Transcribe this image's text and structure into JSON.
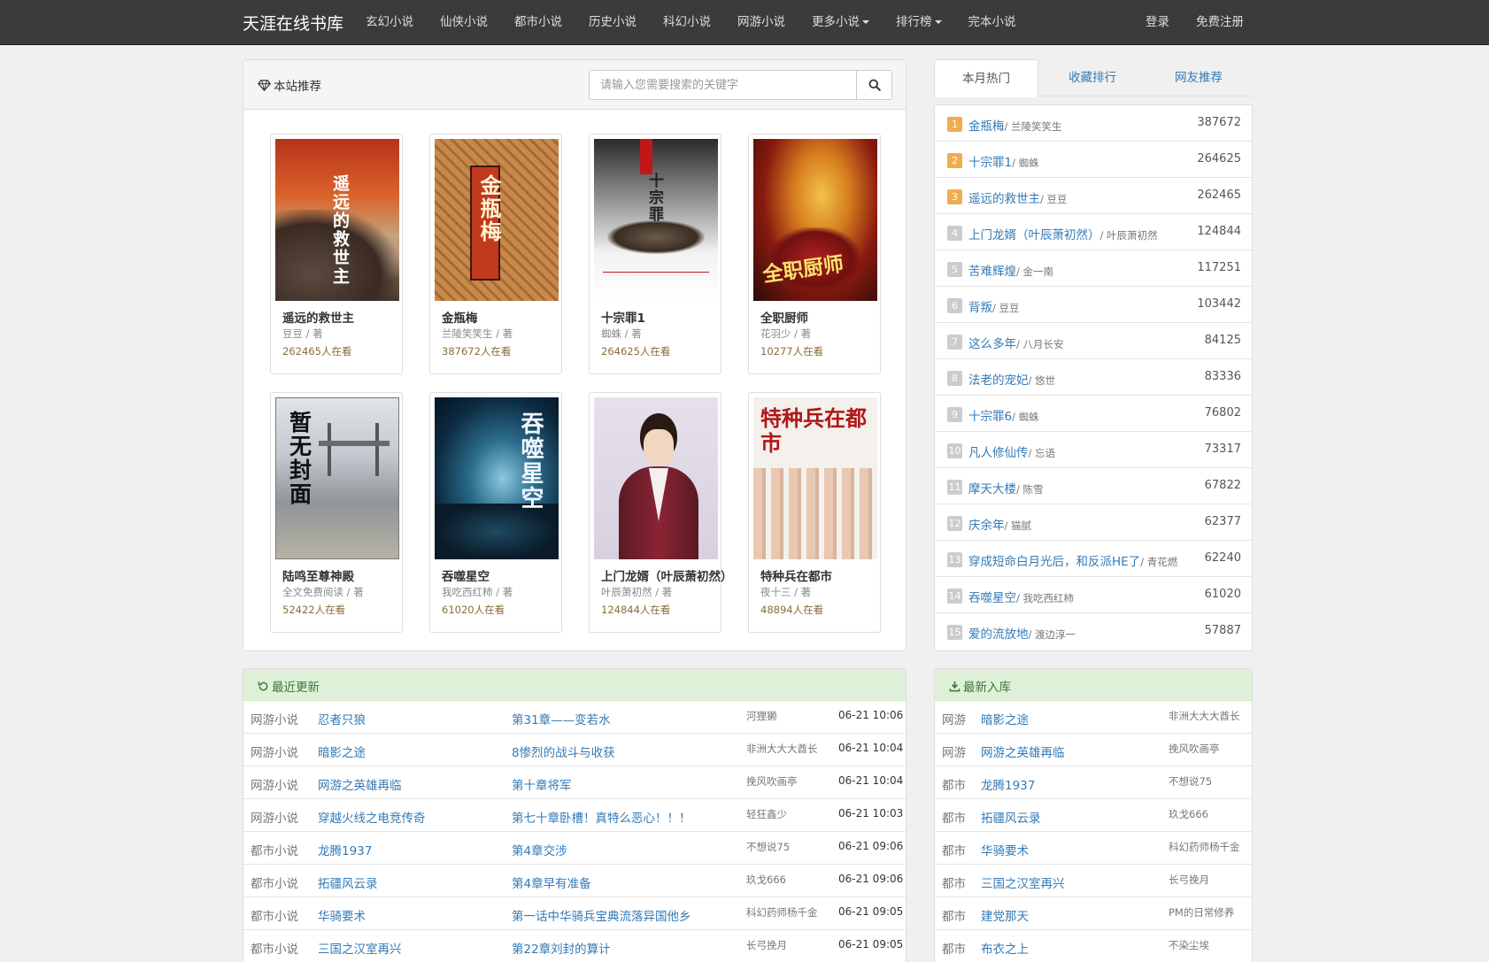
{
  "nav": {
    "brand": "天涯在线书库",
    "links": [
      "玄幻小说",
      "仙侠小说",
      "都市小说",
      "历史小说",
      "科幻小说",
      "网游小说",
      "更多小说",
      "排行榜",
      "完本小说"
    ],
    "login": "登录",
    "register": "免费注册"
  },
  "recommend": {
    "title": "本站推荐",
    "search_placeholder": "请输入您需要搜索的关键字",
    "books": [
      {
        "title": "遥远的救世主",
        "author": "豆豆 / 著",
        "readers": "262465人在看",
        "cover_text": "遥远的救世主"
      },
      {
        "title": "金瓶梅",
        "author": "兰陵笑笑生 / 著",
        "readers": "387672人在看",
        "cover_text": "金瓶梅"
      },
      {
        "title": "十宗罪1",
        "author": "蜘蛛 / 著",
        "readers": "264625人在看",
        "cover_text": "十宗罪"
      },
      {
        "title": "全职厨师",
        "author": "花羽少 / 著",
        "readers": "10277人在看",
        "cover_text": "全职厨师"
      },
      {
        "title": "陆鸣至尊神殿",
        "author": "全文免费阅读 / 著",
        "readers": "52422人在看",
        "cover_text": "暂无封面"
      },
      {
        "title": "吞噬星空",
        "author": "我吃西红柿 / 著",
        "readers": "61020人在看",
        "cover_text": "吞噬星空"
      },
      {
        "title": "上门龙婿（叶辰萧初然）",
        "author": "叶辰萧初然 / 著",
        "readers": "124844人在看",
        "cover_text": ""
      },
      {
        "title": "特种兵在都市",
        "author": "夜十三 / 著",
        "readers": "48894人在看",
        "cover_text": "特种兵在都市"
      }
    ]
  },
  "hot": {
    "tabs": [
      "本月热门",
      "收藏排行",
      "网友推荐"
    ],
    "items": [
      {
        "num": "1",
        "title": "金瓶梅",
        "author": "/ 兰陵笑笑生",
        "count": "387672"
      },
      {
        "num": "2",
        "title": "十宗罪1",
        "author": "/ 蜘蛛",
        "count": "264625"
      },
      {
        "num": "3",
        "title": "遥远的救世主",
        "author": "/ 豆豆",
        "count": "262465"
      },
      {
        "num": "4",
        "title": "上门龙婿（叶辰萧初然）",
        "author": "/ 叶辰萧初然",
        "count": "124844"
      },
      {
        "num": "5",
        "title": "苦难辉煌",
        "author": "/ 金一南",
        "count": "117251"
      },
      {
        "num": "6",
        "title": "背叛",
        "author": "/ 豆豆",
        "count": "103442"
      },
      {
        "num": "7",
        "title": "这么多年",
        "author": "/ 八月长安",
        "count": "84125"
      },
      {
        "num": "8",
        "title": "法老的宠妃",
        "author": "/ 悠世",
        "count": "83336"
      },
      {
        "num": "9",
        "title": "十宗罪6",
        "author": "/ 蜘蛛",
        "count": "76802"
      },
      {
        "num": "10",
        "title": "凡人修仙传",
        "author": "/ 忘语",
        "count": "73317"
      },
      {
        "num": "11",
        "title": "摩天大楼",
        "author": "/ 陈雪",
        "count": "67822"
      },
      {
        "num": "12",
        "title": "庆余年",
        "author": "/ 猫腻",
        "count": "62377"
      },
      {
        "num": "13",
        "title": "穿成短命白月光后，和反派HE了",
        "author": "/ 青花燃",
        "count": "62240"
      },
      {
        "num": "14",
        "title": "吞噬星空",
        "author": "/ 我吃西红柿",
        "count": "61020"
      },
      {
        "num": "15",
        "title": "爱的流放地",
        "author": "/ 渡边淳一",
        "count": "57887"
      }
    ]
  },
  "updates": {
    "title": "最近更新",
    "rows": [
      {
        "cat": "网游小说",
        "book": "忍者只狼",
        "chapter": "第31章——变若水",
        "author": "河狸獭",
        "time": "06-21 10:06"
      },
      {
        "cat": "网游小说",
        "book": "暗影之途",
        "chapter": "8惨烈的战斗与收获",
        "author": "非洲大大大酋长",
        "time": "06-21 10:04"
      },
      {
        "cat": "网游小说",
        "book": "网游之英雄再临",
        "chapter": "第十章将军",
        "author": "挽风吹画亭",
        "time": "06-21 10:04"
      },
      {
        "cat": "网游小说",
        "book": "穿越火线之电竞传奇",
        "chapter": "第七十章卧槽！真特么恶心！！！",
        "author": "轻狂鑫少",
        "time": "06-21 10:03"
      },
      {
        "cat": "都市小说",
        "book": "龙腾1937",
        "chapter": "第4章交涉",
        "author": "不想说75",
        "time": "06-21 09:06"
      },
      {
        "cat": "都市小说",
        "book": "拓疆风云录",
        "chapter": "第4章早有准备",
        "author": "玖戈666",
        "time": "06-21 09:06"
      },
      {
        "cat": "都市小说",
        "book": "华骑要术",
        "chapter": "第一话中华骑兵宝典流落异国他乡",
        "author": "科幻药师杨千金",
        "time": "06-21 09:05"
      },
      {
        "cat": "都市小说",
        "book": "三国之汉室再兴",
        "chapter": "第22章刘封的算计",
        "author": "长弓挽月",
        "time": "06-21 09:05"
      }
    ]
  },
  "newbooks": {
    "title": "最新入库",
    "rows": [
      {
        "cat": "网游",
        "book": "暗影之途",
        "author": "非洲大大大酋长"
      },
      {
        "cat": "网游",
        "book": "网游之英雄再临",
        "author": "挽风吹画亭"
      },
      {
        "cat": "都市",
        "book": "龙腾1937",
        "author": "不想说75"
      },
      {
        "cat": "都市",
        "book": "拓疆风云录",
        "author": "玖戈666"
      },
      {
        "cat": "都市",
        "book": "华骑要术",
        "author": "科幻药师杨千金"
      },
      {
        "cat": "都市",
        "book": "三国之汉室再兴",
        "author": "长弓挽月"
      },
      {
        "cat": "都市",
        "book": "建党那天",
        "author": "PM的日常修养"
      },
      {
        "cat": "都市",
        "book": "布衣之上",
        "author": "不染尘埃"
      }
    ]
  }
}
